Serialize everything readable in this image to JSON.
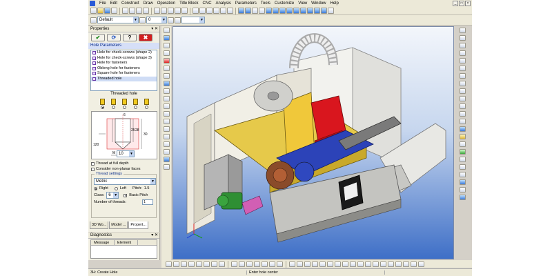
{
  "menubar": {
    "items": [
      "File",
      "Edit",
      "Construct",
      "Draw",
      "Operation",
      "Title Block",
      "CNC",
      "Analysis",
      "Parameters",
      "Tools",
      "Customize",
      "View",
      "Window",
      "Help"
    ]
  },
  "toolbar": {
    "style_value": "Default",
    "layer_value": "0"
  },
  "properties": {
    "title": "Properties",
    "section": "Hole Parameters",
    "hole_types": [
      "Hole for check-screws (shape 2)",
      "Hole for check-screws (shape 3)",
      "Hole for fasteners",
      "Oblong hole for fasteners",
      "Square hole for fasteners",
      "Threaded hole"
    ],
    "selected_hole_label": "Threaded hole",
    "diagram": {
      "dim_top": "6",
      "dim_mid1": "25",
      "dim_mid2": "28",
      "dim_right": "30",
      "dim_left": "120",
      "thread_label": "M",
      "thread_value": "10"
    },
    "checkboxes": {
      "thread_full_depth": "Thread at full depth",
      "non_planar": "Consider non-planar faces"
    },
    "thread_settings": {
      "legend": "Thread settings",
      "type_value": "Metric",
      "right_label": "Right",
      "left_label": "Left",
      "pitch_label": "Pitch:",
      "pitch_value": "1.5",
      "class_label": "Class:",
      "class_value": "6",
      "basic_pitch_label": "Basic Pitch",
      "threads_label": "Number of threads:",
      "threads_value": "1"
    },
    "tabs": [
      "3D Wo...",
      "Model ...",
      "Propert..."
    ]
  },
  "diagnostics": {
    "title": "Diagnostics",
    "columns": [
      "Message",
      "Element"
    ]
  },
  "status": {
    "left": "3H: Create Hole",
    "middle": "Enter hole center"
  }
}
